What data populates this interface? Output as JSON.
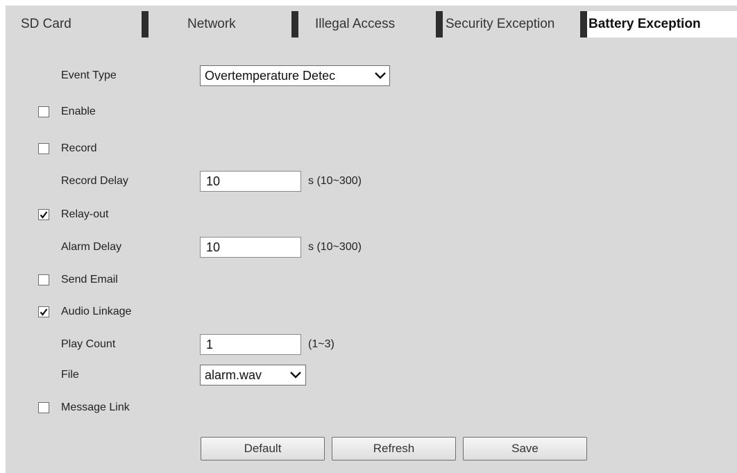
{
  "tabs": [
    {
      "label": "SD Card",
      "active": false
    },
    {
      "label": "Network",
      "active": false
    },
    {
      "label": "Illegal Access",
      "active": false
    },
    {
      "label": "Security Exception",
      "active": false
    },
    {
      "label": "Battery Exception",
      "active": true
    }
  ],
  "form": {
    "event_type": {
      "label": "Event Type",
      "value": "Overtemperature Detec"
    },
    "enable": {
      "label": "Enable",
      "checked": false
    },
    "record": {
      "label": "Record",
      "checked": false
    },
    "record_delay": {
      "label": "Record Delay",
      "value": "10",
      "hint": "s (10~300)"
    },
    "relay_out": {
      "label": "Relay-out",
      "checked": true
    },
    "alarm_delay": {
      "label": "Alarm Delay",
      "value": "10",
      "hint": "s (10~300)"
    },
    "send_email": {
      "label": "Send Email",
      "checked": false
    },
    "audio_linkage": {
      "label": "Audio Linkage",
      "checked": true
    },
    "play_count": {
      "label": "Play Count",
      "value": "1",
      "hint": "(1~3)"
    },
    "file": {
      "label": "File",
      "value": "alarm.wav"
    },
    "message_link": {
      "label": "Message Link",
      "checked": false
    }
  },
  "buttons": {
    "default_label": "Default",
    "refresh_label": "Refresh",
    "save_label": "Save"
  },
  "colors": {
    "panel_bg": "#d9d9d9",
    "tab_separator": "#2e2e2e",
    "active_tab_bg": "#ffffff"
  },
  "icons": {
    "checkmark": "check-icon",
    "dropdown": "chevron-down-icon"
  }
}
